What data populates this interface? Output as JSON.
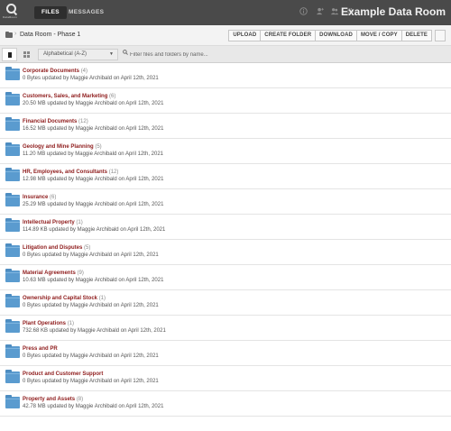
{
  "header": {
    "logo_icon": "dataroom-logo-icon",
    "logo_wordmark": "DataRoom",
    "tabs": [
      {
        "label": "FILES",
        "active": true
      },
      {
        "label": "MESSAGES",
        "active": false
      }
    ],
    "icons": [
      "info-icon",
      "users-icon",
      "groups-icon",
      "gear-icon"
    ],
    "room_title": "Example Data Room"
  },
  "breadcrumb": {
    "icon": "folder-icon",
    "separator": "›",
    "label": "Data Room - Phase 1"
  },
  "actions": {
    "upload": "UPLOAD",
    "create_folder": "CREATE FOLDER",
    "download": "DOWNLOAD",
    "move_copy": "MOVE / COPY",
    "delete": "DELETE"
  },
  "toolbar": {
    "sort_value": "Alphabetical (A-Z)",
    "sort_caret": "▼",
    "filter_icon": "🔍",
    "filter_placeholder": "Filter files and folders by name..."
  },
  "folders": [
    {
      "name": "Corporate Documents",
      "count": "(4)",
      "meta": "0 Bytes updated by Maggie Archibald on April 12th, 2021"
    },
    {
      "name": "Customers, Sales, and Marketing",
      "count": "(6)",
      "meta": "20.50 MB updated by Maggie Archibald on April 12th, 2021"
    },
    {
      "name": "Financial Documents",
      "count": "(12)",
      "meta": "16.52 MB updated by Maggie Archibald on April 12th, 2021"
    },
    {
      "name": "Geology and Mine Planning",
      "count": "(5)",
      "meta": "11.20 MB updated by Maggie Archibald on April 12th, 2021"
    },
    {
      "name": "HR, Employees, and Consultants",
      "count": "(12)",
      "meta": "12.98 MB updated by Maggie Archibald on April 12th, 2021"
    },
    {
      "name": "Insurance",
      "count": "(6)",
      "meta": "25.29 MB updated by Maggie Archibald on April 12th, 2021"
    },
    {
      "name": "Intellectual Property",
      "count": "(1)",
      "meta": "114.89 KB updated by Maggie Archibald on April 12th, 2021"
    },
    {
      "name": "Litigation and Disputes",
      "count": "(5)",
      "meta": "0 Bytes updated by Maggie Archibald on April 12th, 2021"
    },
    {
      "name": "Material Agreements",
      "count": "(9)",
      "meta": "10.63 MB updated by Maggie Archibald on April 12th, 2021"
    },
    {
      "name": "Ownership and Capital Stock",
      "count": "(1)",
      "meta": "0 Bytes updated by Maggie Archibald on April 12th, 2021"
    },
    {
      "name": "Plant Operations",
      "count": "(1)",
      "meta": "732.68 KB updated by Maggie Archibald on April 12th, 2021"
    },
    {
      "name": "Press and PR",
      "count": "",
      "meta": "0 Bytes updated by Maggie Archibald on April 12th, 2021"
    },
    {
      "name": "Product and Customer Support",
      "count": "",
      "meta": "0 Bytes updated by Maggie Archibald on April 12th, 2021"
    },
    {
      "name": "Property and Assets",
      "count": "(8)",
      "meta": "42.78 MB updated by Maggie Archibald on April 12th, 2021"
    }
  ]
}
